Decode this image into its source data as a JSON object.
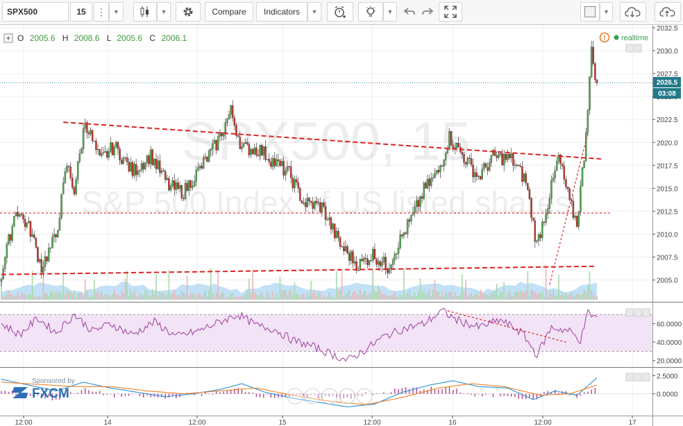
{
  "toolbar": {
    "symbol": "SPX500",
    "interval": "15",
    "compare_label": "Compare",
    "indicators_label": "Indicators",
    "icons": [
      "more-icon",
      "candles-icon",
      "gear-icon",
      "alert-icon",
      "bulb-icon",
      "undo-icon",
      "redo-icon",
      "fullscreen-icon",
      "color-swatch-icon",
      "cloud-download-icon",
      "cloud-upload-icon"
    ]
  },
  "legend": {
    "o_label": "O",
    "o_value": "2005.6",
    "h_label": "H",
    "h_value": "2008.6",
    "l_label": "L",
    "l_value": "2005.6",
    "c_label": "C",
    "c_value": "2006.1",
    "realtime_label": "realtime"
  },
  "watermark": {
    "line1": "SPX500, 15",
    "line2": "S&P 500 Index of US listed shares"
  },
  "sponsor": {
    "text": "Sponsored by",
    "brand": "FXCM"
  },
  "price_tags": {
    "last": "2026.5",
    "countdown": "03:08"
  },
  "colors": {
    "up": "#53a653",
    "down": "#c0392b",
    "trendline": "#e02020",
    "rsi": "#9b3f9b",
    "volume": "#8fc9ef",
    "macd": "#2a8fd6",
    "signal": "#f07f24",
    "hist": "#b0408f"
  },
  "chart_data": {
    "type": "candlestick",
    "symbol": "SPX500",
    "interval": "15",
    "ylim": [
      2003,
      2032.5
    ],
    "y_ticks": [
      "2032.5",
      "2030.0",
      "2027.5",
      "2025.0",
      "2022.5",
      "2020.0",
      "2017.5",
      "2015.0",
      "2012.5",
      "2010.0",
      "2007.5",
      "2005.0"
    ],
    "x_ticks": [
      "12:00",
      "14",
      "12:00",
      "15",
      "12:00",
      "16",
      "12:00",
      "17"
    ],
    "close_path": [
      {
        "x": 0,
        "y": 2005.6
      },
      {
        "x": 8,
        "y": 2012.8
      },
      {
        "x": 16,
        "y": 2010.4
      },
      {
        "x": 22,
        "y": 2006.4
      },
      {
        "x": 30,
        "y": 2009.8
      },
      {
        "x": 36,
        "y": 2017.6
      },
      {
        "x": 40,
        "y": 2014.8
      },
      {
        "x": 46,
        "y": 2022.4
      },
      {
        "x": 54,
        "y": 2018.0
      },
      {
        "x": 62,
        "y": 2019.6
      },
      {
        "x": 72,
        "y": 2016.8
      },
      {
        "x": 82,
        "y": 2018.6
      },
      {
        "x": 92,
        "y": 2015.2
      },
      {
        "x": 100,
        "y": 2014.6
      },
      {
        "x": 110,
        "y": 2017.4
      },
      {
        "x": 118,
        "y": 2019.8
      },
      {
        "x": 126,
        "y": 2023.4
      },
      {
        "x": 132,
        "y": 2019.4
      },
      {
        "x": 142,
        "y": 2019.2
      },
      {
        "x": 150,
        "y": 2017.8
      },
      {
        "x": 158,
        "y": 2016.6
      },
      {
        "x": 166,
        "y": 2013.4
      },
      {
        "x": 176,
        "y": 2013.0
      },
      {
        "x": 186,
        "y": 2008.8
      },
      {
        "x": 196,
        "y": 2006.6
      },
      {
        "x": 204,
        "y": 2007.8
      },
      {
        "x": 212,
        "y": 2006.4
      },
      {
        "x": 218,
        "y": 2009.0
      },
      {
        "x": 226,
        "y": 2012.0
      },
      {
        "x": 232,
        "y": 2014.8
      },
      {
        "x": 240,
        "y": 2016.8
      },
      {
        "x": 246,
        "y": 2020.6
      },
      {
        "x": 254,
        "y": 2018.4
      },
      {
        "x": 262,
        "y": 2016.2
      },
      {
        "x": 270,
        "y": 2018.4
      },
      {
        "x": 280,
        "y": 2018.2
      },
      {
        "x": 288,
        "y": 2015.8
      },
      {
        "x": 294,
        "y": 2008.8
      },
      {
        "x": 300,
        "y": 2013.4
      },
      {
        "x": 306,
        "y": 2018.4
      },
      {
        "x": 312,
        "y": 2013.4
      },
      {
        "x": 316,
        "y": 2011.2
      },
      {
        "x": 320,
        "y": 2018.6
      },
      {
        "x": 324,
        "y": 2029.8
      },
      {
        "x": 327,
        "y": 2026.5
      }
    ],
    "resistance_line": [
      {
        "x": 34,
        "y": 2022.2
      },
      {
        "x": 327,
        "y": 2018.2
      }
    ],
    "support_line": [
      {
        "x": 0,
        "y": 2005.6
      },
      {
        "x": 327,
        "y": 2006.5
      }
    ],
    "horizontal_level": 2012.3,
    "last_price": 2026.5,
    "rsi": {
      "ticks": [
        "60.0000",
        "40.0000",
        "20.0000"
      ],
      "ylim": [
        16,
        80
      ],
      "upper": 70,
      "lower": 30,
      "path": [
        {
          "x": 0,
          "y": 60
        },
        {
          "x": 10,
          "y": 48
        },
        {
          "x": 20,
          "y": 66
        },
        {
          "x": 30,
          "y": 50
        },
        {
          "x": 40,
          "y": 70
        },
        {
          "x": 50,
          "y": 52
        },
        {
          "x": 60,
          "y": 60
        },
        {
          "x": 72,
          "y": 48
        },
        {
          "x": 84,
          "y": 62
        },
        {
          "x": 96,
          "y": 46
        },
        {
          "x": 108,
          "y": 52
        },
        {
          "x": 120,
          "y": 62
        },
        {
          "x": 130,
          "y": 70
        },
        {
          "x": 140,
          "y": 58
        },
        {
          "x": 150,
          "y": 54
        },
        {
          "x": 160,
          "y": 42
        },
        {
          "x": 170,
          "y": 36
        },
        {
          "x": 180,
          "y": 28
        },
        {
          "x": 190,
          "y": 20
        },
        {
          "x": 200,
          "y": 32
        },
        {
          "x": 210,
          "y": 46
        },
        {
          "x": 220,
          "y": 54
        },
        {
          "x": 232,
          "y": 60
        },
        {
          "x": 242,
          "y": 74
        },
        {
          "x": 250,
          "y": 64
        },
        {
          "x": 262,
          "y": 56
        },
        {
          "x": 274,
          "y": 64
        },
        {
          "x": 286,
          "y": 50
        },
        {
          "x": 294,
          "y": 26
        },
        {
          "x": 302,
          "y": 56
        },
        {
          "x": 312,
          "y": 52
        },
        {
          "x": 318,
          "y": 42
        },
        {
          "x": 322,
          "y": 72
        },
        {
          "x": 327,
          "y": 66
        }
      ],
      "trend_line": [
        {
          "x": 245,
          "y": 74
        },
        {
          "x": 310,
          "y": 40
        }
      ]
    },
    "macd": {
      "ticks": [
        "2.5000",
        "0.0000"
      ],
      "ylim": [
        -2.8,
        3.4
      ],
      "macd_path": [
        {
          "x": 0,
          "y": 2.0
        },
        {
          "x": 15,
          "y": 1.2
        },
        {
          "x": 30,
          "y": 0.4
        },
        {
          "x": 45,
          "y": 1.6
        },
        {
          "x": 60,
          "y": 0.8
        },
        {
          "x": 75,
          "y": 0.2
        },
        {
          "x": 90,
          "y": -0.4
        },
        {
          "x": 105,
          "y": 0.0
        },
        {
          "x": 120,
          "y": 0.6
        },
        {
          "x": 132,
          "y": 1.4
        },
        {
          "x": 145,
          "y": 0.2
        },
        {
          "x": 160,
          "y": -0.6
        },
        {
          "x": 175,
          "y": -1.2
        },
        {
          "x": 190,
          "y": -1.8
        },
        {
          "x": 205,
          "y": -1.4
        },
        {
          "x": 220,
          "y": 0.2
        },
        {
          "x": 235,
          "y": 1.2
        },
        {
          "x": 248,
          "y": 1.8
        },
        {
          "x": 262,
          "y": 1.0
        },
        {
          "x": 278,
          "y": 0.8
        },
        {
          "x": 292,
          "y": -0.8
        },
        {
          "x": 304,
          "y": 0.4
        },
        {
          "x": 316,
          "y": -0.2
        },
        {
          "x": 327,
          "y": 2.2
        }
      ],
      "signal_path": [
        {
          "x": 0,
          "y": 1.6
        },
        {
          "x": 20,
          "y": 1.3
        },
        {
          "x": 40,
          "y": 1.0
        },
        {
          "x": 60,
          "y": 1.0
        },
        {
          "x": 80,
          "y": 0.4
        },
        {
          "x": 100,
          "y": 0.0
        },
        {
          "x": 120,
          "y": 0.4
        },
        {
          "x": 140,
          "y": 0.8
        },
        {
          "x": 160,
          "y": -0.2
        },
        {
          "x": 180,
          "y": -1.0
        },
        {
          "x": 200,
          "y": -1.5
        },
        {
          "x": 220,
          "y": -0.5
        },
        {
          "x": 240,
          "y": 0.8
        },
        {
          "x": 258,
          "y": 1.4
        },
        {
          "x": 276,
          "y": 1.0
        },
        {
          "x": 296,
          "y": -0.2
        },
        {
          "x": 312,
          "y": 0.0
        },
        {
          "x": 327,
          "y": 1.2
        }
      ]
    }
  }
}
